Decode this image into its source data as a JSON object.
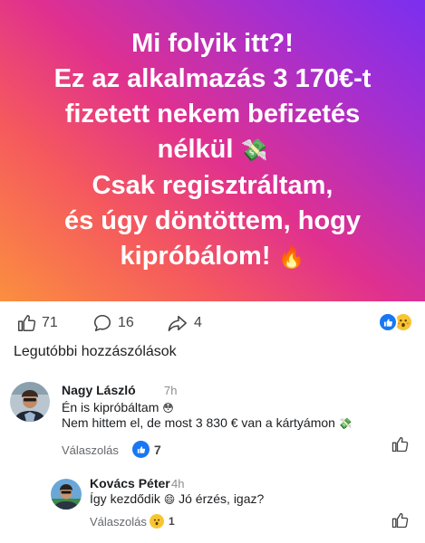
{
  "hero": {
    "lines": [
      "Mi folyik itt?!",
      "Ez az alkalmazás 3 170€-t",
      "fizetett nekem befizetés",
      "nélkül",
      "Csak regisztráltam,",
      "és úgy döntöttem, hogy",
      "kipróbálom!"
    ],
    "emoji_money": "💸",
    "emoji_fire": "🔥"
  },
  "stats": {
    "likes": "71",
    "comments": "16",
    "shares": "4"
  },
  "section_title": "Legutóbbi hozzászólások",
  "comments": [
    {
      "name": "Nagy László",
      "time": "7h",
      "text_line1": "Én is kipróbáltam",
      "text_line1_emoji": "😳",
      "text_line2": "Nem hittem el, de most 3 830 € van a kártyámon",
      "text_line2_emoji": "💸",
      "reply_label": "Válaszolás",
      "reaction_count": "7"
    },
    {
      "name": "Kovács Péter",
      "time": "4h",
      "text": "Így kezdődik",
      "text_emoji": "😄",
      "text_after": "Jó érzés, igaz?",
      "reply_label": "Válaszolás",
      "reaction_count": "1"
    }
  ],
  "colors": {
    "accent": "#1877f2",
    "wow": "#f7c531",
    "muted": "#65676b"
  },
  "icons": [
    "like-icon",
    "comment-icon",
    "share-icon",
    "thumb-up-icon"
  ]
}
